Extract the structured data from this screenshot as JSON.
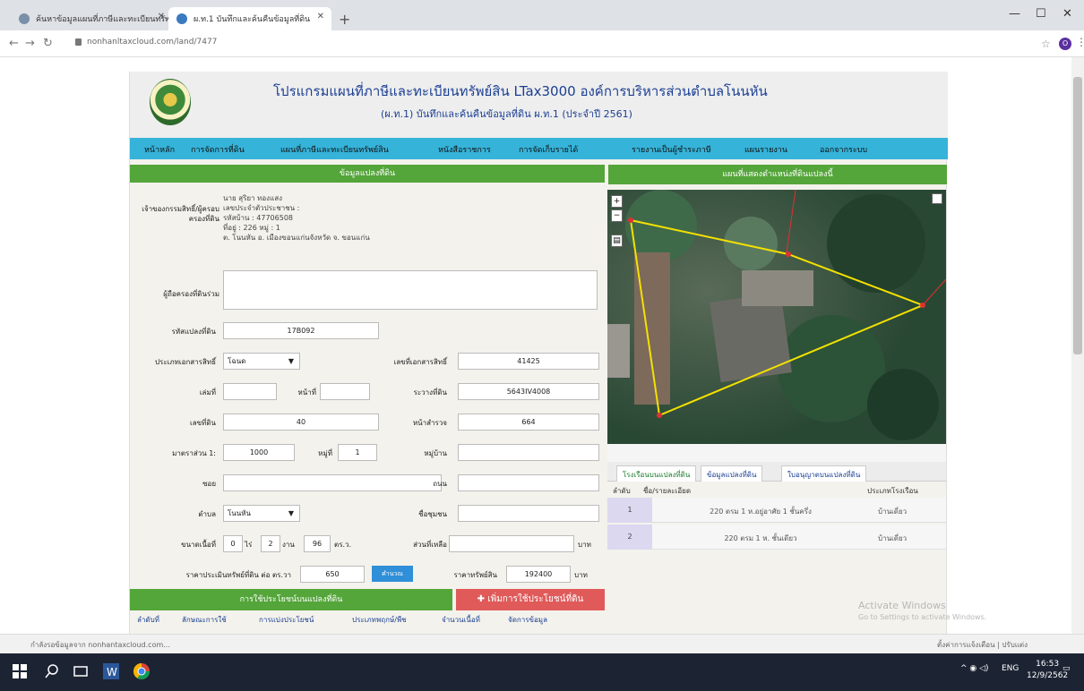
{
  "browser": {
    "tabs": [
      {
        "label": "ค้นหาข้อมูลแผนที่ภาษีและทะเบียนทรัพย์สิน"
      },
      {
        "label": "ผ.ท.1 บันทึกและค้นคืนข้อมูลที่ดิน"
      }
    ],
    "url": "nonhanltaxcloud.com/land/7477",
    "profile_initial": "O"
  },
  "app": {
    "title": "โปรแกรมแผนที่ภาษีและทะเบียนทรัพย์สิน LTax3000 องค์การบริหารส่วนตำบลโนนหัน",
    "subtitle": "(ผ.ท.1) บันทึกและค้นคืนข้อมูลที่ดิน ผ.ท.1 (ประจำปี 2561)",
    "menu": [
      "หน้าหลัก",
      "การจัดการที่ดิน",
      "แผนที่ภาษีและทะเบียนทรัพย์สิน",
      "หนังสือราชการ",
      "การจัดเก็บรายได้",
      "รายงานเป็นผู้ชำระภาษี",
      "แผนรายงาน",
      "ออกจากระบบ"
    ]
  },
  "form": {
    "section_title": "ข้อมูลแปลงที่ดิน",
    "owner_label": "เจ้าของกรรมสิทธิ์/ผู้ครอบครองที่ดิน",
    "owner_info": [
      "นาย สุริยา ทองแสง",
      "เลขประจำตัวประชาชน :",
      "รหัสบ้าน : 47706508",
      "ที่อยู่ : 226  หมู่ : 1",
      "ต. โนนหัน  อ. เมืองขอนแก่นจังหวัด  จ. ขอนแก่น"
    ],
    "other_label": "ผู้ถือครองที่ดินร่วม",
    "parcel_code_label": "รหัสแปลงที่ดิน",
    "parcel_code": "17B092",
    "doc_type_label": "ประเภทเอกสารสิทธิ์",
    "doc_type": "โฉนด",
    "doc_no_label": "เลขที่เอกสารสิทธิ์",
    "doc_no": "41425",
    "book_label": "เล่มที่",
    "page_label": "หน้าที่",
    "book": "",
    "page": "",
    "map_ref_label": "ระวางที่ดิน",
    "map_ref": "5643IV4008",
    "land_no_label": "เลขที่ดิน",
    "land_no": "40",
    "survey_label": "หน้าสำรวจ",
    "survey": "664",
    "scale_label": "มาตราส่วน 1:",
    "scale": "1000",
    "moo_label": "หมู่ที่",
    "moo": "1",
    "village_label": "หมู่บ้าน",
    "village": "",
    "soi_label": "ซอย",
    "soi": "",
    "road_label": "ถนน",
    "road": "",
    "tambon_label": "ตำบล",
    "tambon": "โนนหัน",
    "building_name_label": "ชื่อชุมชน",
    "building_name": "",
    "area_label": "ขนาดเนื้อที่",
    "area_rai": "0",
    "area_rai_unit": "ไร่",
    "area_ngan": "2",
    "area_ngan_unit": "งาน",
    "area_wa": "96",
    "area_wa_unit": "ตร.ว.",
    "remark_label": "ส่วนที่เหลือ",
    "remark": "",
    "remark_unit": "บาท",
    "price_label": "ราคาประเมินทรัพย์ที่ดิน ต่อ ตร.วา",
    "price": "650",
    "calc_button": "คำนวณ",
    "total_label": "ราคาทรัพย์สิน",
    "total": "192400",
    "total_unit": "บาท"
  },
  "map": {
    "title": "แผนที่แสดงตำแหน่งที่ดินแปลงนี้",
    "zoom_in": "+",
    "zoom_out": "−"
  },
  "parcel_tabs": [
    "โรงเรือนบนแปลงที่ดิน",
    "ข้อมูลแปลงที่ดิน",
    "ใบอนุญาตบนแปลงที่ดิน"
  ],
  "parcel_table": {
    "headers": [
      "ลำดับ",
      "ชื่อ/รายละเอียด",
      "ประเภทโรงเรือน"
    ],
    "rows": [
      {
        "no": "1",
        "desc": "220 ตรม 1 ห.อยู่อาศัย 1 ชั้นครึ่ง",
        "type": "บ้านเดี่ยว"
      },
      {
        "no": "2",
        "desc": "220 ตรม 1 ห. ชั้นเดียว",
        "type": "บ้านเดี่ยว"
      }
    ]
  },
  "bottom": {
    "usage_header": "การใช้ประโยชน์บนแปลงที่ดิน",
    "add_button": "เพิ่มการใช้ประโยชน์ที่ดิน",
    "cols": [
      "ลำดับที่",
      "ลักษณะการใช้",
      "การแบ่งประโยชน์",
      "ประเภทพฤกษ์/พืช",
      "จำนวนเนื้อที่",
      "จัดการข้อมูล"
    ]
  },
  "watermark": {
    "line1": "Activate Windows",
    "line2": "Go to Settings to activate Windows."
  },
  "status": {
    "left": "กำลังรอข้อมูลจาก nonhantaxcloud.com...",
    "right": "ตั้งค่าการแจ้งเตือน | ปรับแต่ง"
  },
  "taskbar": {
    "lang": "ENG",
    "time": "16:53",
    "date": "12/9/2562"
  }
}
